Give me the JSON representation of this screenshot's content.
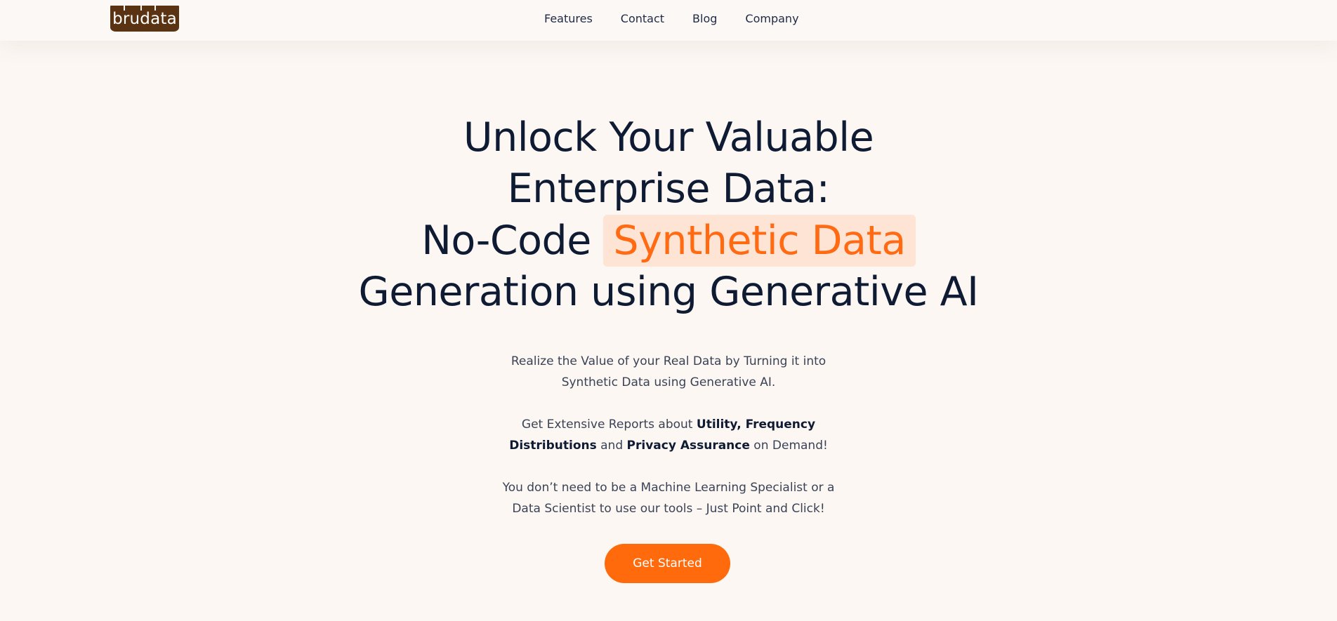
{
  "brand": {
    "logo_text": "brudata",
    "logo_color": "#5a3412"
  },
  "nav": {
    "items": [
      {
        "label": "Features"
      },
      {
        "label": "Contact"
      },
      {
        "label": "Blog"
      },
      {
        "label": "Company"
      }
    ]
  },
  "hero": {
    "headline_line1": "Unlock Your Valuable",
    "headline_line2": "Enterprise Data:",
    "headline_line3_prefix": "No-Code ",
    "headline_highlight": "Synthetic Data",
    "headline_line4": "Generation using Generative AI",
    "paragraph1": "Realize the Value of your Real Data by Turning it into Synthetic Data using Generative AI.",
    "paragraph2": {
      "part1": "Get Extensive Reports about ",
      "bold1": "Utility, Frequency Distributions",
      "part2": " and ",
      "bold2": "Privacy Assurance",
      "part3": " on Demand!"
    },
    "paragraph3": "You don’t need to be a Machine Learning Specialist or a Data Scientist to use our tools – Just Point and Click!",
    "cta_label": "Get Started"
  },
  "colors": {
    "background": "#fcf7f3",
    "accent": "#ff6a13",
    "highlight_bg": "#fde4d4",
    "heading": "#0f1b33"
  }
}
